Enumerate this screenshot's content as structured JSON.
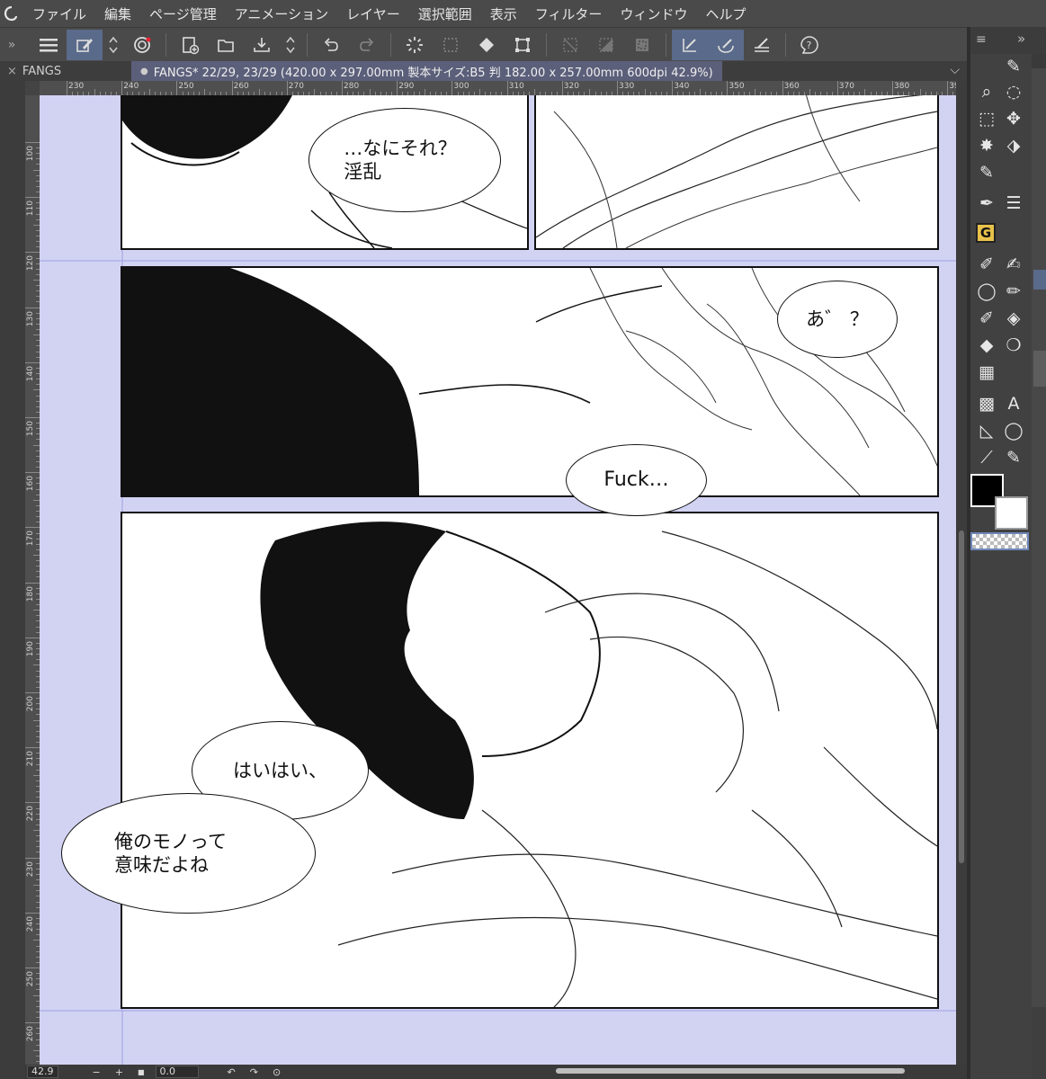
{
  "app": {
    "logo_icon": "clip-studio-logo"
  },
  "menu": [
    "ファイル",
    "編集",
    "ページ管理",
    "アニメーション",
    "レイヤー",
    "選択範囲",
    "表示",
    "フィルター",
    "ウィンドウ",
    "ヘルプ"
  ],
  "toolbar": {
    "left_toggle": "»",
    "icons": [
      "hamburger-menu-icon",
      "edit-mode-icon",
      "updown-arrows-icon",
      "clip-studio-icon",
      "new-file-icon",
      "open-folder-icon",
      "save-icon",
      "updown-arrows-icon",
      "undo-icon",
      "redo-icon",
      "busy-indicator-icon",
      "deselect-icon",
      "fill-bucket-icon",
      "transform-icon",
      "clear-icon",
      "fill-selection-icon",
      "invert-selection-icon",
      "snap-to-ruler-icon",
      "snap-to-special-ruler-icon",
      "snap-to-grid-icon",
      "help-icon"
    ]
  },
  "tabs": {
    "tab1_label": "FANGS",
    "tab1_close": "×",
    "tab2_label": "FANGS* 22/29, 23/29 (420.00 x 297.00mm 製本サイズ:B5 判 182.00 x 257.00mm 600dpi 42.9%)",
    "tab2_dot": "●",
    "chevron": "⌵"
  },
  "ruler": {
    "h_ticks": [
      "230",
      "240",
      "250",
      "260",
      "270",
      "280",
      "290",
      "300",
      "310",
      "320",
      "330",
      "340",
      "350",
      "360",
      "370",
      "380",
      "39"
    ],
    "v_ticks": [
      "100",
      "110",
      "120",
      "130",
      "140",
      "150",
      "160",
      "170",
      "180",
      "190",
      "200",
      "210",
      "220",
      "230",
      "240",
      "250",
      "260"
    ]
  },
  "comic": {
    "bubble1": "…なにそれ？\n淫乱",
    "bubble2": "あ゛ ？",
    "bubble3": "Fuck…",
    "bubble4": "はいはい、",
    "bubble5": "俺のモノって\n意味だよね"
  },
  "bottom": {
    "zoom": "42.9",
    "minus": "−",
    "plus": "+",
    "stop": "■",
    "angle": "0.0",
    "rotate_left": "↶",
    "rotate_right": "↷",
    "reset": "⊙"
  },
  "right_panel": {
    "collapse": "»",
    "tools": [
      "zoom-icon",
      "lasso-select-icon",
      "rect-select-icon",
      "move-icon",
      "magic-wand-icon",
      "move-layer-icon",
      "eyedropper-icon",
      "pen-icon",
      "layers-icon",
      "g-pen-icon",
      "brush-icon",
      "lasso-fill-icon",
      "marker-icon",
      "pencil-icon",
      "eraser-icon",
      "fill-icon",
      "blur-icon",
      "gradient-icon",
      "tone-icon",
      "text-icon",
      "figure-icon",
      "balloon-icon",
      "ruler-icon",
      "brush-line-icon"
    ],
    "g_label": "G",
    "main_color": "#000000",
    "sub_color": "#ffffff"
  }
}
